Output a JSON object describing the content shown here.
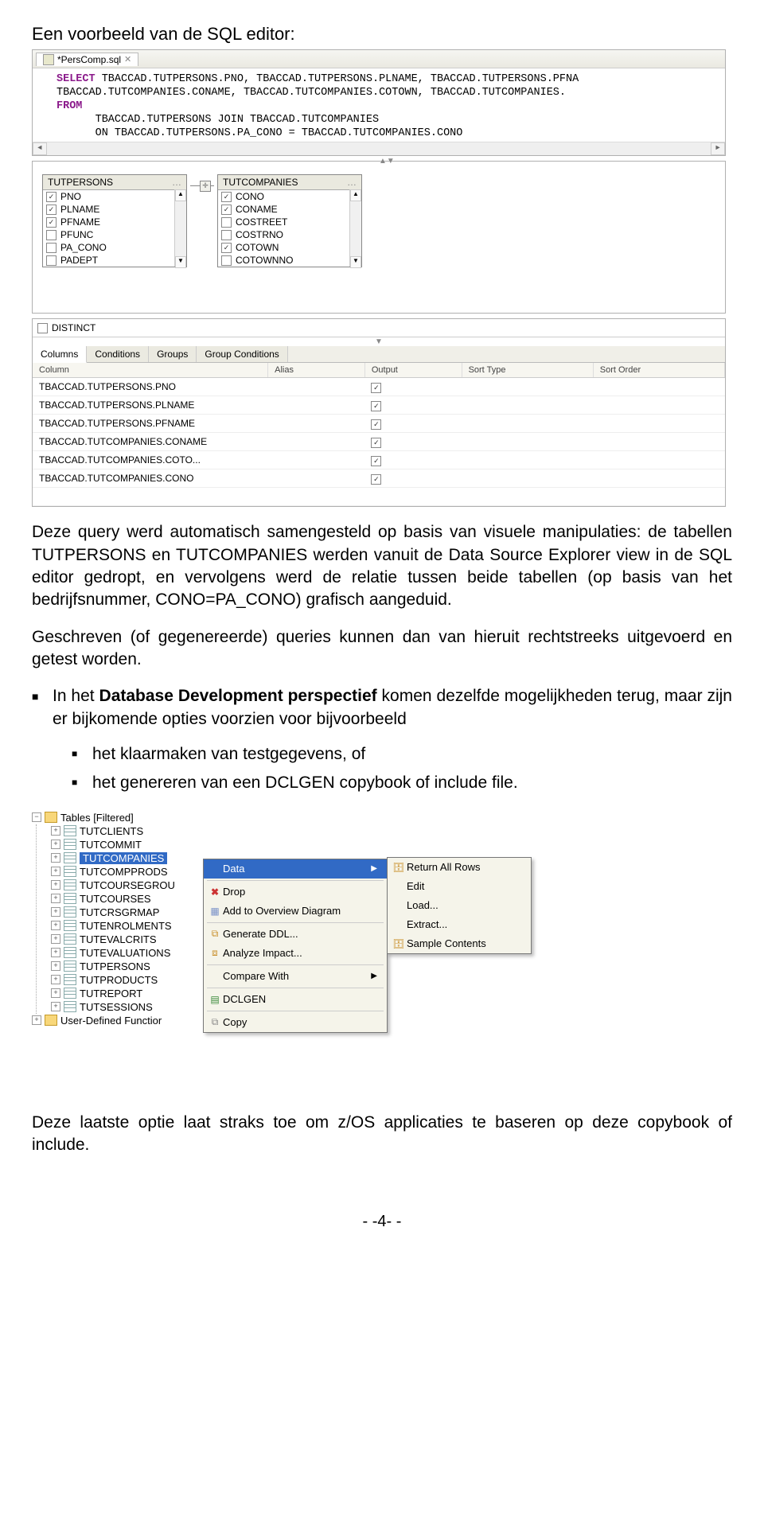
{
  "heading": "Een voorbeeld van de SQL editor:",
  "sql_editor": {
    "file_tab": "*PersComp.sql",
    "code_lines": [
      {
        "kw": "SELECT",
        "rest": " TBACCAD.TUTPERSONS.PNO, TBACCAD.TUTPERSONS.PLNAME, TBACCAD.TUTPERSONS.PFNA"
      },
      {
        "kw": "",
        "rest": "TBACCAD.TUTCOMPANIES.CONAME, TBACCAD.TUTCOMPANIES.COTOWN, TBACCAD.TUTCOMPANIES."
      },
      {
        "kw": "FROM",
        "rest": ""
      },
      {
        "kw": "",
        "rest": "      TBACCAD.TUTPERSONS JOIN TBACCAD.TUTCOMPANIES"
      },
      {
        "kw": "",
        "rest": "      ON TBACCAD.TUTPERSONS.PA_CONO = TBACCAD.TUTCOMPANIES.CONO",
        "leading_kw": "      "
      }
    ]
  },
  "tables": {
    "left": {
      "name": "TUTPERSONS",
      "cols": [
        {
          "name": "PNO",
          "checked": true
        },
        {
          "name": "PLNAME",
          "checked": true
        },
        {
          "name": "PFNAME",
          "checked": true
        },
        {
          "name": "PFUNC",
          "checked": false
        },
        {
          "name": "PA_CONO",
          "checked": false
        },
        {
          "name": "PADEPT",
          "checked": false
        }
      ]
    },
    "right": {
      "name": "TUTCOMPANIES",
      "cols": [
        {
          "name": "CONO",
          "checked": true
        },
        {
          "name": "CONAME",
          "checked": true
        },
        {
          "name": "COSTREET",
          "checked": false
        },
        {
          "name": "COSTRNO",
          "checked": false
        },
        {
          "name": "COTOWN",
          "checked": true
        },
        {
          "name": "COTOWNNO",
          "checked": false
        }
      ]
    }
  },
  "distinct_label": "DISTINCT",
  "lower_tabs": [
    "Columns",
    "Conditions",
    "Groups",
    "Group Conditions"
  ],
  "grid_headers": [
    "Column",
    "Alias",
    "Output",
    "Sort Type",
    "Sort Order"
  ],
  "grid_rows": [
    {
      "col": "TBACCAD.TUTPERSONS.PNO",
      "out": true
    },
    {
      "col": "TBACCAD.TUTPERSONS.PLNAME",
      "out": true
    },
    {
      "col": "TBACCAD.TUTPERSONS.PFNAME",
      "out": true
    },
    {
      "col": "TBACCAD.TUTCOMPANIES.CONAME",
      "out": true
    },
    {
      "col": "TBACCAD.TUTCOMPANIES.COTO...",
      "out": true
    },
    {
      "col": "TBACCAD.TUTCOMPANIES.CONO",
      "out": true
    }
  ],
  "para1": "Deze query werd automatisch samengesteld op basis van visuele manipulaties: de tabellen TUTPERSONS en TUTCOMPANIES werden vanuit de Data Source Explorer view in de SQL editor gedropt, en vervolgens werd de relatie tussen beide tabellen (op basis van het bedrijfsnummer, CONO=PA_CONO) grafisch aangeduid.",
  "para2": "Geschreven (of gegenereerde) queries kunnen dan van hieruit rechtstreeks uitgevoerd en getest worden.",
  "bullet1_pre": "In het ",
  "bullet1_bold": "Database Development perspectief",
  "bullet1_post": " komen dezelfde mogelijkheden terug, maar zijn er bijkomende opties voorzien voor bijvoorbeeld",
  "sub_bullets": [
    "het klaarmaken van testgegevens, of",
    "het genereren van een DCLGEN copybook of include file."
  ],
  "tree": {
    "root": "Tables [Filtered]",
    "items": [
      "TUTCLIENTS",
      "TUTCOMMIT",
      "TUTCOMPANIES",
      "TUTCOMPPRODS",
      "TUTCOURSEGROU",
      "TUTCOURSES",
      "TUTCRSGRMAP",
      "TUTENROLMENTS",
      "TUTEVALCRITS",
      "TUTEVALUATIONS",
      "TUTPERSONS",
      "TUTPRODUCTS",
      "TUTREPORT",
      "TUTSESSIONS"
    ],
    "selected_index": 2,
    "footer": "User-Defined Functior"
  },
  "context_menu": {
    "items": [
      {
        "label": "Data",
        "arrow": true,
        "sel": true
      },
      {
        "label": "Drop",
        "icon": "x"
      },
      {
        "label": "Add to Overview Diagram",
        "icon": "grid"
      },
      {
        "label": "Generate DDL...",
        "icon": "ddl"
      },
      {
        "label": "Analyze Impact...",
        "icon": "impact"
      },
      {
        "label": "Compare With",
        "arrow": true
      },
      {
        "label": "DCLGEN",
        "icon": "dclgen"
      },
      {
        "label": "Copy",
        "icon": "copy"
      }
    ]
  },
  "submenu": {
    "items": [
      {
        "label": "Return All Rows",
        "icon": true
      },
      {
        "label": "Edit"
      },
      {
        "label": "Load..."
      },
      {
        "label": "Extract..."
      },
      {
        "label": "Sample Contents",
        "icon": true
      }
    ]
  },
  "para3": "Deze laatste optie laat straks toe om z/OS applicaties te baseren op deze copybook of include.",
  "page_footer": "- -4- -"
}
